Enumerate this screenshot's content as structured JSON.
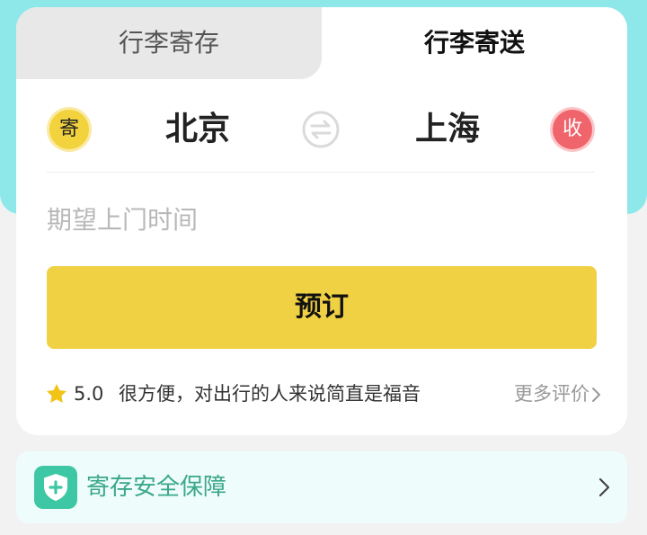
{
  "tabs": [
    {
      "label": "行李寄存",
      "active": false
    },
    {
      "label": "行李寄送",
      "active": true
    }
  ],
  "route": {
    "send_badge": "寄",
    "receive_badge": "收",
    "from_city": "北京",
    "to_city": "上海",
    "swap_icon": "swap-arrows-icon"
  },
  "pickup_time": {
    "placeholder": "期望上门时间"
  },
  "book_button": {
    "label": "预订"
  },
  "review": {
    "rating": "5.0",
    "text": "很方便，对出行的人来说简直是福音",
    "more_label": "更多评价"
  },
  "safety": {
    "label": "寄存安全保障"
  },
  "colors": {
    "teal_header": "#8ee8ea",
    "accent_yellow": "#f1d144",
    "receive_red": "#f0646c",
    "safety_green": "#3ec7a4"
  }
}
